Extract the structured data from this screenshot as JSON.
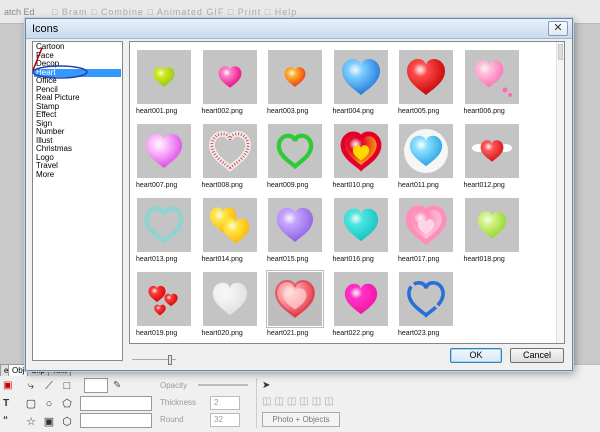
{
  "background": {
    "first_tab": "atch Ed",
    "other_tabs": "□ Bram  □ Combine  □ Animated GIF  □ Print  □ Help",
    "bottom_tabs": [
      "e",
      "Obj",
      "Clip",
      "Text"
    ],
    "opacity_label": "Opacity",
    "thickness_label": "Thickness",
    "thickness_value": "2",
    "round_label": "Round",
    "round_value": "32",
    "photo_objects_button": "Photo + Objects"
  },
  "dialog": {
    "title": "Icons",
    "close_glyph": "✕",
    "ok_label": "OK",
    "cancel_label": "Cancel",
    "categories": [
      "Cartoon",
      "Face",
      "Decop",
      "Heart",
      "Office",
      "Pencil",
      "Real Picture",
      "Stamp",
      "Effect",
      "Sign",
      "Number",
      "Illust",
      "Christmas",
      "Logo",
      "Travel",
      "More"
    ],
    "selected_category": "Heart",
    "thumbnail_size_fraction": 0.9
  },
  "icons": [
    {
      "name": "heart001.png",
      "style": "solid",
      "color": "#d2ec1a",
      "fill2": "#8fc21c",
      "size": 0.55
    },
    {
      "name": "heart002.png",
      "style": "solid",
      "color": "#ff7fc6",
      "fill2": "#e4007f",
      "size": 0.6
    },
    {
      "name": "heart003.png",
      "style": "solid",
      "color": "#ffb42a",
      "fill2": "#e8330e",
      "size": 0.55
    },
    {
      "name": "heart004.png",
      "style": "solid",
      "color": "#7fd0ff",
      "fill2": "#1a72d8",
      "size": 1.0
    },
    {
      "name": "heart005.png",
      "style": "solid",
      "color": "#ff4a4a",
      "fill2": "#c00000",
      "size": 1.0
    },
    {
      "name": "heart006.png",
      "style": "solid-dots",
      "color": "#ffc0dc",
      "fill2": "#ff69b4",
      "size": 0.75
    },
    {
      "name": "heart007.png",
      "style": "solid",
      "color": "#ffc8ff",
      "fill2": "#d843e3",
      "size": 0.95
    },
    {
      "name": "heart008.png",
      "style": "dotted",
      "color": "#d9473f",
      "fill2": "#ffffff",
      "size": 0.95
    },
    {
      "name": "heart009.png",
      "style": "outline",
      "color": "#2fca38",
      "fill2": "#c4c4c4",
      "size": 0.85
    },
    {
      "name": "heart010.png",
      "style": "ring",
      "color": "#e4002b",
      "fill2": "#ffd800",
      "size": 0.95
    },
    {
      "name": "heart011.png",
      "style": "solid-splash",
      "color": "#8fe0ff",
      "fill2": "#1f9fe0",
      "size": 0.85
    },
    {
      "name": "heart012.png",
      "style": "solid-wings",
      "color": "#ff5959",
      "fill2": "#d01010",
      "size": 0.6
    },
    {
      "name": "heart013.png",
      "style": "outline",
      "color": "#8fd4d0",
      "fill2": "#c4c4c4",
      "size": 0.9
    },
    {
      "name": "heart014.png",
      "style": "double",
      "color": "#ffe84a",
      "fill2": "#ffb000",
      "size": 0.7
    },
    {
      "name": "heart015.png",
      "style": "solid",
      "color": "#c7a5ff",
      "fill2": "#8a5bdc",
      "size": 0.95
    },
    {
      "name": "heart016.png",
      "style": "solid",
      "color": "#4ee8e0",
      "fill2": "#0fbfc0",
      "size": 0.9
    },
    {
      "name": "heart017.png",
      "style": "ring",
      "color": "#ff8fb8",
      "fill2": "#ffd4e6",
      "size": 0.95
    },
    {
      "name": "heart018.png",
      "style": "solid",
      "color": "#d5f58a",
      "fill2": "#8cd22a",
      "size": 0.75
    },
    {
      "name": "heart019.png",
      "style": "multi",
      "color": "#ff3b3b",
      "fill2": "#d00000",
      "size": 0.5
    },
    {
      "name": "heart020.png",
      "style": "solid",
      "color": "#f4f4f4",
      "fill2": "#dedede",
      "size": 0.9
    },
    {
      "name": "heart021.png",
      "style": "glow",
      "color": "#ffb0b0",
      "fill2": "#e02a3a",
      "size": 1.0
    },
    {
      "name": "heart022.png",
      "style": "solid",
      "color": "#ff33c8",
      "fill2": "#f0129e",
      "size": 0.85
    },
    {
      "name": "heart023.png",
      "style": "outline-thick",
      "color": "#2a6fd8",
      "fill2": "#c4c4c4",
      "size": 0.9
    }
  ],
  "selected_icon": "heart021.png",
  "annotation_color": "#b00000",
  "annotation_ring_color": "#2a3fa8"
}
